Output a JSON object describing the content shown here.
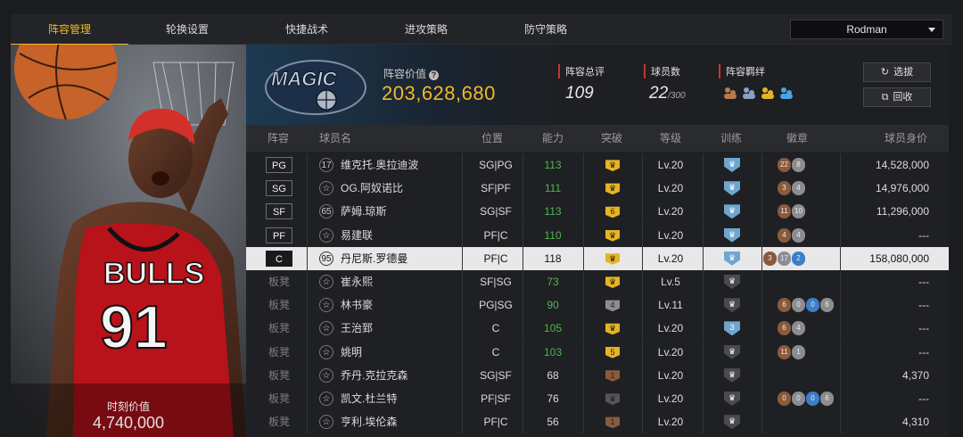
{
  "tabs": [
    "阵容管理",
    "轮换设置",
    "快捷战术",
    "进攻策略",
    "防守策略"
  ],
  "active_tab": 0,
  "dropdown_selected": "Rodman",
  "portrait": {
    "value_label": "时刻价值",
    "value": "4,740,000",
    "jersey": "91",
    "team_text": "BULLS"
  },
  "summary": {
    "lineup_value_label": "阵容价值",
    "lineup_value": "203,628,680",
    "rating_label": "阵容总评",
    "rating": "109",
    "count_label": "球员数",
    "count": "22",
    "count_max": "/300",
    "bond_label": "阵容羁绊",
    "select_button": "选拔",
    "recycle_button": "回收",
    "team_logo_text": "MAGIC"
  },
  "columns": [
    "阵容",
    "球员名",
    "位置",
    "能力",
    "突破",
    "等级",
    "训练",
    "徽章",
    "球员身价"
  ],
  "colors": {
    "accent": "#f2b82b",
    "ability_green": "#4fb64f",
    "gold": "#e6b423",
    "silver": "#8c8d90",
    "bronze": "#8a5a3c",
    "blue": "#3c7ec8"
  },
  "rows": [
    {
      "slot": "PG",
      "rank": "17",
      "name": "维克托.奥拉迪波",
      "pos": "SG|PG",
      "ability": "113",
      "level": "Lv.20",
      "price": "14,528,000",
      "hi": true
    },
    {
      "slot": "SG",
      "rank": "",
      "name": "OG.阿奴诺比",
      "pos": "SF|PF",
      "ability": "111",
      "level": "Lv.20",
      "price": "14,976,000",
      "hi": true
    },
    {
      "slot": "SF",
      "rank": "65",
      "name": "萨姆.琼斯",
      "pos": "SG|SF",
      "ability": "113",
      "level": "Lv.20",
      "price": "11,296,000",
      "hi": true
    },
    {
      "slot": "PF",
      "rank": "",
      "name": "易建联",
      "pos": "PF|C",
      "ability": "110",
      "level": "Lv.20",
      "price": "---",
      "hi": true
    },
    {
      "slot": "C",
      "rank": "95",
      "name": "丹尼斯.罗德曼",
      "pos": "PF|C",
      "ability": "118",
      "level": "Lv.20",
      "price": "158,080,000",
      "hi": false
    },
    {
      "slot": "板凳",
      "rank": "",
      "name": "崔永熙",
      "pos": "SF|SG",
      "ability": "73",
      "level": "Lv.5",
      "price": "---",
      "hi": true
    },
    {
      "slot": "板凳",
      "rank": "",
      "name": "林书豪",
      "pos": "PG|SG",
      "ability": "90",
      "level": "Lv.11",
      "price": "---",
      "hi": true
    },
    {
      "slot": "板凳",
      "rank": "",
      "name": "王治郅",
      "pos": "C",
      "ability": "105",
      "level": "Lv.20",
      "price": "---",
      "hi": true
    },
    {
      "slot": "板凳",
      "rank": "",
      "name": "姚明",
      "pos": "C",
      "ability": "103",
      "level": "Lv.20",
      "price": "---",
      "hi": true
    },
    {
      "slot": "板凳",
      "rank": "",
      "name": "乔丹.克拉克森",
      "pos": "SG|SF",
      "ability": "68",
      "level": "Lv.20",
      "price": "4,370",
      "hi": false
    },
    {
      "slot": "板凳",
      "rank": "",
      "name": "凯文.杜兰特",
      "pos": "PF|SF",
      "ability": "76",
      "level": "Lv.20",
      "price": "---",
      "hi": false
    },
    {
      "slot": "板凳",
      "rank": "",
      "name": "亨利.埃伦森",
      "pos": "PF|C",
      "ability": "56",
      "level": "Lv.20",
      "price": "4,310",
      "hi": false
    }
  ],
  "breakout_marks": [
    "",
    "",
    "6",
    "",
    "",
    "",
    "4",
    "",
    "5",
    "1",
    "",
    "1"
  ],
  "training_marks": [
    "",
    "",
    "",
    "",
    "",
    "",
    "",
    "3",
    "",
    "",
    "",
    ""
  ],
  "medal_counts": [
    [
      "22",
      "8"
    ],
    [
      "3",
      "4"
    ],
    [
      "11",
      "10"
    ],
    [
      "4",
      "4"
    ],
    [
      "3",
      "17",
      "2"
    ],
    [],
    [
      "6",
      "0",
      "0",
      "6"
    ],
    [
      "6",
      "4"
    ],
    [
      "11",
      "1"
    ],
    [],
    [
      "0",
      "0",
      "0",
      "6"
    ],
    []
  ]
}
